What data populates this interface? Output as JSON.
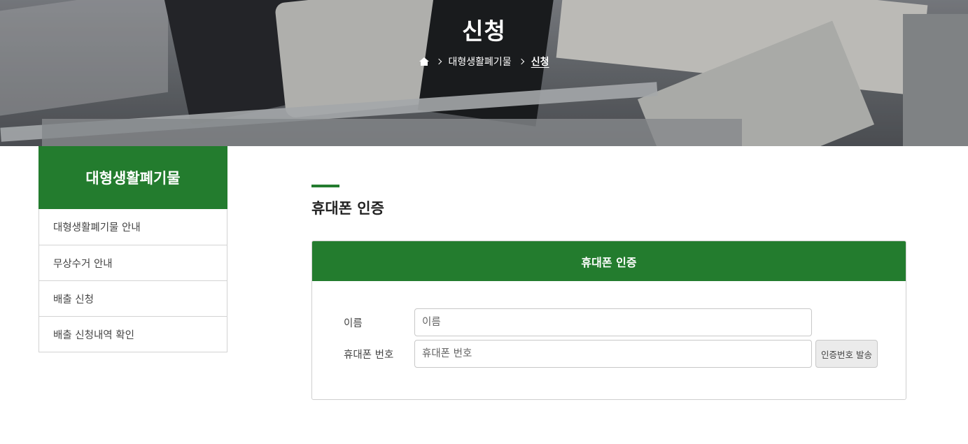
{
  "hero": {
    "title": "신청",
    "breadcrumb": {
      "home_icon": "home-icon",
      "items": [
        "대형생활폐기물",
        "신청"
      ]
    }
  },
  "sidebar": {
    "title": "대형생활폐기물",
    "items": [
      {
        "label": "대형생활폐기물 안내"
      },
      {
        "label": "무상수거 안내"
      },
      {
        "label": "배출 신청"
      },
      {
        "label": "배출 신청내역 확인"
      }
    ]
  },
  "main": {
    "section_title": "휴대폰 인증",
    "card": {
      "header": "휴대폰 인증",
      "name_label": "이름",
      "name_placeholder": "이름",
      "name_value": "",
      "phone_label": "휴대폰 번호",
      "phone_placeholder": "휴대폰 번호",
      "phone_value": "",
      "send_button": "인증번호 발송"
    }
  },
  "colors": {
    "brand_green": "#237c2e"
  }
}
